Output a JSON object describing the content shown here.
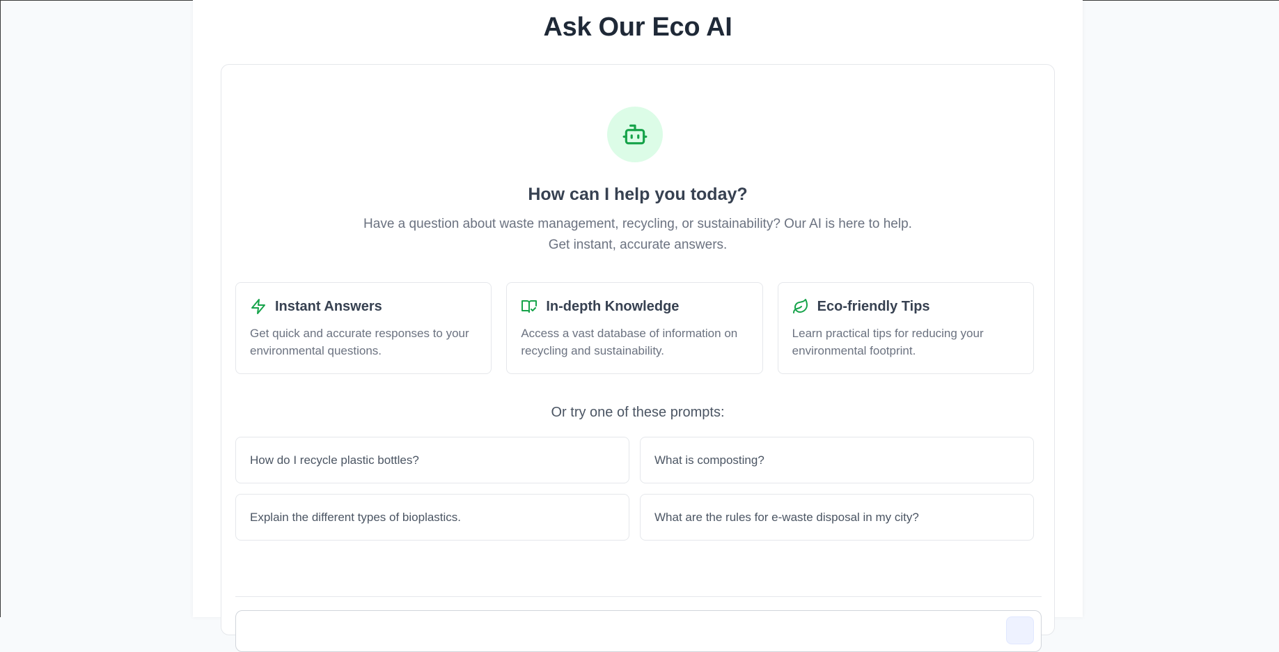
{
  "header": {
    "title": "Ask Our Eco AI"
  },
  "welcome": {
    "icon": "bot-icon",
    "title": "How can I help you today?",
    "subtitle_line1": "Have a question about waste management, recycling, or sustainability? Our AI is here to help.",
    "subtitle_line2": "Get instant, accurate answers."
  },
  "features": [
    {
      "icon": "zap-icon",
      "title": "Instant Answers",
      "desc": "Get quick and accurate responses to your environmental questions."
    },
    {
      "icon": "book-check-icon",
      "title": "In-depth Knowledge",
      "desc": "Access a vast database of information on recycling and sustainability."
    },
    {
      "icon": "leaf-icon",
      "title": "Eco-friendly Tips",
      "desc": "Learn practical tips for reducing your environmental footprint."
    }
  ],
  "prompts": {
    "label": "Or try one of these prompts:",
    "items": [
      "How do I recycle plastic bottles?",
      "What is composting?",
      "Explain the different types of bioplastics.",
      "What are the rules for e-waste disposal in my city?"
    ]
  },
  "colors": {
    "accent": "#16a34a",
    "accent_bg": "#dcfce7",
    "text_dark": "#1f2937",
    "text_muted": "#6b7280",
    "border": "#e5e7eb"
  }
}
